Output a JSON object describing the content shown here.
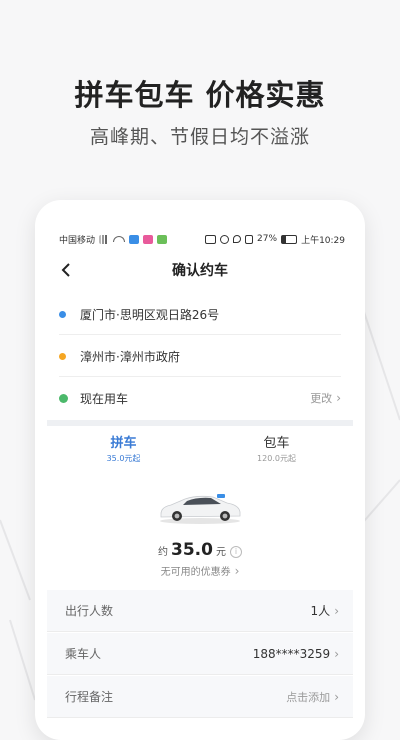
{
  "promo": {
    "headline": "拼车包车 价格实惠",
    "subheadline": "高峰期、节假日均不溢涨"
  },
  "status_bar": {
    "carrier": "中国移动",
    "battery": "27%",
    "time": "上午10:29"
  },
  "nav": {
    "title": "确认约车"
  },
  "route": {
    "origin": "厦门市·思明区观日路26号",
    "destination": "漳州市·漳州市政府",
    "time_label": "现在用车",
    "change_label": "更改",
    "origin_color": "#3a8ee6",
    "destination_color": "#f5a623",
    "time_color": "#4cb96b"
  },
  "tabs": [
    {
      "label": "拼车",
      "price": "35.0元起",
      "active": true
    },
    {
      "label": "包车",
      "price": "120.0元起",
      "active": false
    }
  ],
  "fare": {
    "prefix": "约",
    "amount": "35.0",
    "unit": "元",
    "coupon": "无可用的优惠券"
  },
  "options": [
    {
      "label": "出行人数",
      "value": "1人"
    },
    {
      "label": "乘车人",
      "value": "188****3259"
    },
    {
      "label": "行程备注",
      "value": "点击添加"
    }
  ],
  "colors": {
    "accent": "#3a7bd5"
  }
}
